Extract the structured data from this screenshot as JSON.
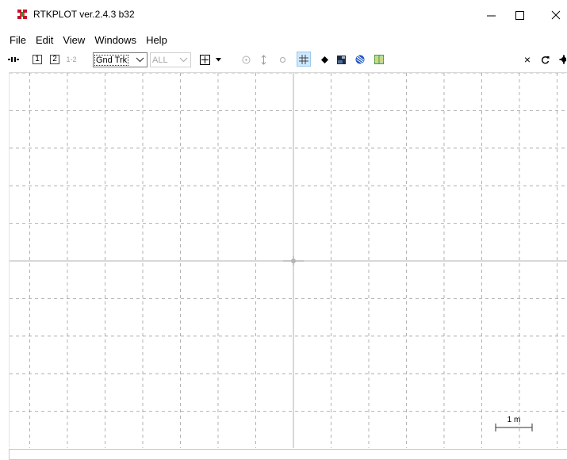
{
  "window": {
    "title": "RTKPLOT ver.2.4.3 b32",
    "controls": {
      "minimize": "—",
      "maximize": "☐",
      "close": "✕"
    }
  },
  "menu": [
    "File",
    "Edit",
    "View",
    "Windows",
    "Help"
  ],
  "toolbar": {
    "solution1": "1",
    "solution2": "2",
    "solution12": "1-2",
    "plot_type": "Gnd Trk",
    "satellite_filter": "ALL",
    "close_glyph": "×"
  },
  "plot": {
    "scale_label": "1 m",
    "grid": true,
    "colors": {
      "grid": "#a0a0a0",
      "axis": "#b0b0b0",
      "origin": "#b4b4b4",
      "scale": "#303030"
    }
  },
  "colors": {
    "grid_button_bg": "#cfe8fb",
    "icon_marker_black": "#000000",
    "icon_sky_blue": "#1e56c8",
    "icon_map_green": "#4a9a3a"
  }
}
